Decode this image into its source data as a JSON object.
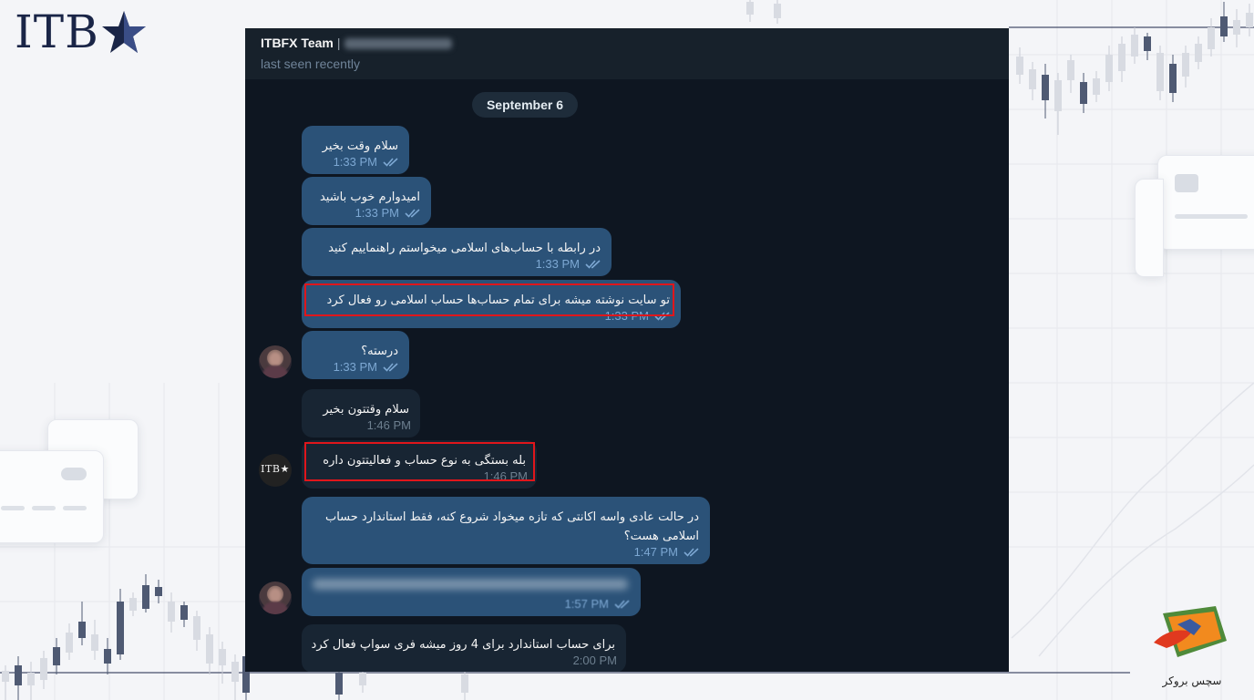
{
  "brand": {
    "logo_text": "ITB",
    "logo_icon": "star-icon",
    "badge_text": "سچس بروکر"
  },
  "chat": {
    "title": "ITBFX Team",
    "separator": "|",
    "status": "last seen recently",
    "date_label": "September 6",
    "messages": [
      {
        "text": "سلام وقت بخیر",
        "time": "1:33 PM",
        "direction": "out",
        "read": true
      },
      {
        "text": "امیدوارم خوب باشید",
        "time": "1:33 PM",
        "direction": "out",
        "read": true
      },
      {
        "text": "در رابطه با حساب‌های اسلامی میخواستم راهنماییم کنید",
        "time": "1:33 PM",
        "direction": "out",
        "read": true
      },
      {
        "text": "تو سایت نوشته میشه برای تمام حساب‌ها حساب اسلامی رو فعال کرد",
        "time": "1:33 PM",
        "direction": "out",
        "read": true,
        "highlighted": true
      },
      {
        "text": "درسته؟",
        "time": "1:33 PM",
        "direction": "out",
        "read": true
      },
      {
        "text": "سلام وقتتون بخیر",
        "time": "1:46 PM",
        "direction": "in"
      },
      {
        "text": "بله بستگی به نوع حساب و فعالیتتون داره",
        "time": "1:46 PM",
        "direction": "in",
        "highlighted": true
      },
      {
        "text": "در حالت عادی واسه اکانتی که تازه میخواد شروع کنه، فقط استاندارد حساب اسلامی هست؟",
        "time": "1:47 PM",
        "direction": "out",
        "read": true
      },
      {
        "text": "",
        "time": "1:57 PM",
        "direction": "out",
        "read": true,
        "blurred": true
      },
      {
        "text": "برای حساب استاندارد برای 4 روز میشه فری سواپ فعال کرد",
        "time": "2:00 PM",
        "direction": "in"
      }
    ]
  },
  "colors": {
    "chat_bg": "#0e1621",
    "header_bg": "#17212b",
    "outgoing_bubble": "#2b5278",
    "incoming_bubble": "#182533",
    "highlight_box": "#e0161b",
    "logo_navy": "#1a2547"
  }
}
